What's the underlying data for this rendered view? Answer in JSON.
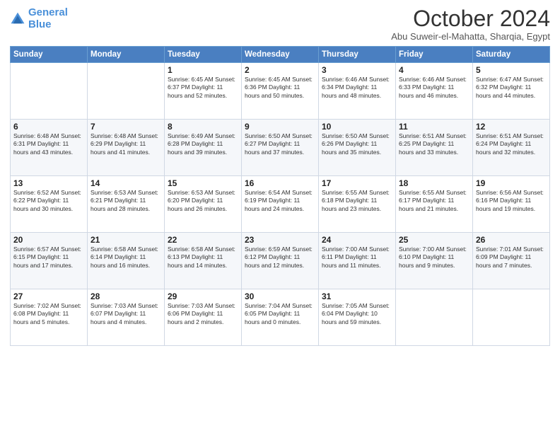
{
  "logo": {
    "line1": "General",
    "line2": "Blue"
  },
  "header": {
    "month_year": "October 2024",
    "location": "Abu Suweir-el-Mahatta, Sharqia, Egypt"
  },
  "days_of_week": [
    "Sunday",
    "Monday",
    "Tuesday",
    "Wednesday",
    "Thursday",
    "Friday",
    "Saturday"
  ],
  "weeks": [
    [
      {
        "day": "",
        "info": ""
      },
      {
        "day": "",
        "info": ""
      },
      {
        "day": "1",
        "info": "Sunrise: 6:45 AM\nSunset: 6:37 PM\nDaylight: 11 hours and 52 minutes."
      },
      {
        "day": "2",
        "info": "Sunrise: 6:45 AM\nSunset: 6:36 PM\nDaylight: 11 hours and 50 minutes."
      },
      {
        "day": "3",
        "info": "Sunrise: 6:46 AM\nSunset: 6:34 PM\nDaylight: 11 hours and 48 minutes."
      },
      {
        "day": "4",
        "info": "Sunrise: 6:46 AM\nSunset: 6:33 PM\nDaylight: 11 hours and 46 minutes."
      },
      {
        "day": "5",
        "info": "Sunrise: 6:47 AM\nSunset: 6:32 PM\nDaylight: 11 hours and 44 minutes."
      }
    ],
    [
      {
        "day": "6",
        "info": "Sunrise: 6:48 AM\nSunset: 6:31 PM\nDaylight: 11 hours and 43 minutes."
      },
      {
        "day": "7",
        "info": "Sunrise: 6:48 AM\nSunset: 6:29 PM\nDaylight: 11 hours and 41 minutes."
      },
      {
        "day": "8",
        "info": "Sunrise: 6:49 AM\nSunset: 6:28 PM\nDaylight: 11 hours and 39 minutes."
      },
      {
        "day": "9",
        "info": "Sunrise: 6:50 AM\nSunset: 6:27 PM\nDaylight: 11 hours and 37 minutes."
      },
      {
        "day": "10",
        "info": "Sunrise: 6:50 AM\nSunset: 6:26 PM\nDaylight: 11 hours and 35 minutes."
      },
      {
        "day": "11",
        "info": "Sunrise: 6:51 AM\nSunset: 6:25 PM\nDaylight: 11 hours and 33 minutes."
      },
      {
        "day": "12",
        "info": "Sunrise: 6:51 AM\nSunset: 6:24 PM\nDaylight: 11 hours and 32 minutes."
      }
    ],
    [
      {
        "day": "13",
        "info": "Sunrise: 6:52 AM\nSunset: 6:22 PM\nDaylight: 11 hours and 30 minutes."
      },
      {
        "day": "14",
        "info": "Sunrise: 6:53 AM\nSunset: 6:21 PM\nDaylight: 11 hours and 28 minutes."
      },
      {
        "day": "15",
        "info": "Sunrise: 6:53 AM\nSunset: 6:20 PM\nDaylight: 11 hours and 26 minutes."
      },
      {
        "day": "16",
        "info": "Sunrise: 6:54 AM\nSunset: 6:19 PM\nDaylight: 11 hours and 24 minutes."
      },
      {
        "day": "17",
        "info": "Sunrise: 6:55 AM\nSunset: 6:18 PM\nDaylight: 11 hours and 23 minutes."
      },
      {
        "day": "18",
        "info": "Sunrise: 6:55 AM\nSunset: 6:17 PM\nDaylight: 11 hours and 21 minutes."
      },
      {
        "day": "19",
        "info": "Sunrise: 6:56 AM\nSunset: 6:16 PM\nDaylight: 11 hours and 19 minutes."
      }
    ],
    [
      {
        "day": "20",
        "info": "Sunrise: 6:57 AM\nSunset: 6:15 PM\nDaylight: 11 hours and 17 minutes."
      },
      {
        "day": "21",
        "info": "Sunrise: 6:58 AM\nSunset: 6:14 PM\nDaylight: 11 hours and 16 minutes."
      },
      {
        "day": "22",
        "info": "Sunrise: 6:58 AM\nSunset: 6:13 PM\nDaylight: 11 hours and 14 minutes."
      },
      {
        "day": "23",
        "info": "Sunrise: 6:59 AM\nSunset: 6:12 PM\nDaylight: 11 hours and 12 minutes."
      },
      {
        "day": "24",
        "info": "Sunrise: 7:00 AM\nSunset: 6:11 PM\nDaylight: 11 hours and 11 minutes."
      },
      {
        "day": "25",
        "info": "Sunrise: 7:00 AM\nSunset: 6:10 PM\nDaylight: 11 hours and 9 minutes."
      },
      {
        "day": "26",
        "info": "Sunrise: 7:01 AM\nSunset: 6:09 PM\nDaylight: 11 hours and 7 minutes."
      }
    ],
    [
      {
        "day": "27",
        "info": "Sunrise: 7:02 AM\nSunset: 6:08 PM\nDaylight: 11 hours and 5 minutes."
      },
      {
        "day": "28",
        "info": "Sunrise: 7:03 AM\nSunset: 6:07 PM\nDaylight: 11 hours and 4 minutes."
      },
      {
        "day": "29",
        "info": "Sunrise: 7:03 AM\nSunset: 6:06 PM\nDaylight: 11 hours and 2 minutes."
      },
      {
        "day": "30",
        "info": "Sunrise: 7:04 AM\nSunset: 6:05 PM\nDaylight: 11 hours and 0 minutes."
      },
      {
        "day": "31",
        "info": "Sunrise: 7:05 AM\nSunset: 6:04 PM\nDaylight: 10 hours and 59 minutes."
      },
      {
        "day": "",
        "info": ""
      },
      {
        "day": "",
        "info": ""
      }
    ]
  ]
}
